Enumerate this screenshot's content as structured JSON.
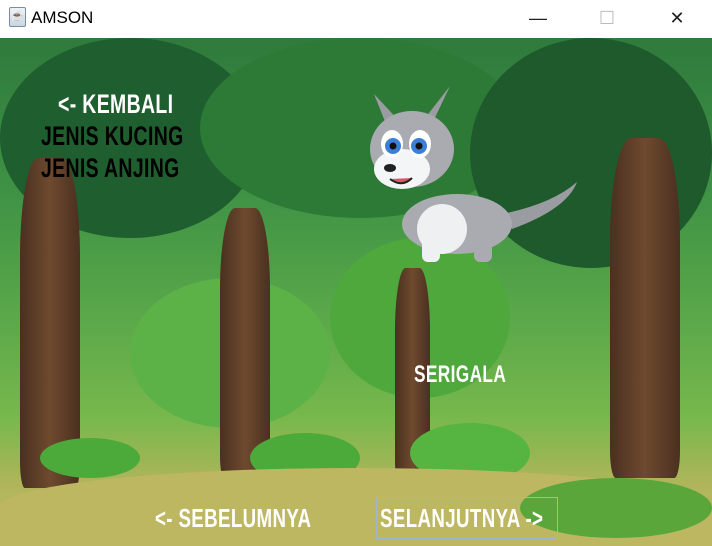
{
  "window": {
    "title": "AMSON",
    "minimize": "—",
    "maximize": "☐",
    "close": "✕"
  },
  "menu": {
    "back": "<- KEMBALI",
    "cats": "JENIS KUCING",
    "dogs": "JENIS ANJING"
  },
  "animal": {
    "name": "SERIGALA",
    "image": "wolf-cartoon"
  },
  "nav": {
    "prev": "<- SEBELUMNYA",
    "next": "SELANJUTNYA ->"
  }
}
